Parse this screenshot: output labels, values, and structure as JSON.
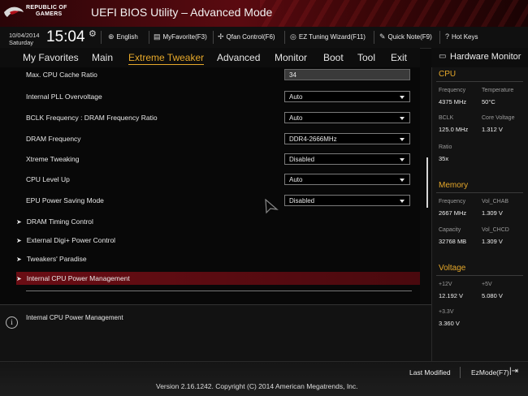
{
  "header": {
    "brand_line1": "REPUBLIC OF",
    "brand_line2": "GAMERS",
    "title": "UEFI BIOS Utility – Advanced Mode"
  },
  "infobar": {
    "date": "10/04/2014",
    "day": "Saturday",
    "time": "15:04",
    "items": [
      {
        "label": "English",
        "icon": "globe-icon"
      },
      {
        "label": "MyFavorite(F3)",
        "icon": "favorite-icon"
      },
      {
        "label": "Qfan Control(F6)",
        "icon": "fan-icon"
      },
      {
        "label": "EZ Tuning Wizard(F11)",
        "icon": "wizard-icon"
      },
      {
        "label": "Quick Note(F9)",
        "icon": "note-icon"
      },
      {
        "label": "Hot Keys",
        "icon": "hotkeys-icon"
      }
    ]
  },
  "nav": {
    "tabs": [
      "My Favorites",
      "Main",
      "Extreme Tweaker",
      "Advanced",
      "Monitor",
      "Boot",
      "Tool",
      "Exit"
    ],
    "active": "Extreme Tweaker"
  },
  "settings": [
    {
      "label": "Max. CPU Cache Ratio",
      "value": "34",
      "type": "text"
    },
    {
      "label": "Internal PLL Overvoltage",
      "value": "Auto",
      "type": "dropdown"
    },
    {
      "label": "BCLK Frequency : DRAM Frequency Ratio",
      "value": "Auto",
      "type": "dropdown"
    },
    {
      "label": "DRAM Frequency",
      "value": "DDR4-2666MHz",
      "type": "dropdown"
    },
    {
      "label": "Xtreme Tweaking",
      "value": "Disabled",
      "type": "dropdown"
    },
    {
      "label": "CPU Level Up",
      "value": "Auto",
      "type": "dropdown"
    },
    {
      "label": "EPU Power Saving Mode",
      "value": "Disabled",
      "type": "dropdown"
    }
  ],
  "submenus": [
    "DRAM Timing Control",
    "External Digi+ Power Control",
    "Tweakers' Paradise",
    "Internal CPU Power Management"
  ],
  "selected_submenu": "Internal CPU Power Management",
  "help_text": "Internal CPU Power Management",
  "hardware_monitor": {
    "title": "Hardware Monitor",
    "cpu": {
      "heading": "CPU",
      "frequency_label": "Frequency",
      "frequency": "4375 MHz",
      "temperature_label": "Temperature",
      "temperature": "50°C",
      "bclk_label": "BCLK",
      "bclk": "125.0 MHz",
      "core_voltage_label": "Core Voltage",
      "core_voltage": "1.312 V",
      "ratio_label": "Ratio",
      "ratio": "35x"
    },
    "memory": {
      "heading": "Memory",
      "frequency_label": "Frequency",
      "frequency": "2667 MHz",
      "vol_chab_label": "Vol_CHAB",
      "vol_chab": "1.309 V",
      "capacity_label": "Capacity",
      "capacity": "32768 MB",
      "vol_chcd_label": "Vol_CHCD",
      "vol_chcd": "1.309 V"
    },
    "voltage": {
      "heading": "Voltage",
      "v12_label": "+12V",
      "v12": "12.192 V",
      "v5_label": "+5V",
      "v5": "5.080 V",
      "v33_label": "+3.3V",
      "v33": "3.360 V"
    }
  },
  "footer": {
    "last_modified": "Last Modified",
    "ezmode": "EzMode(F7)",
    "version": "Version 2.16.1242. Copyright (C) 2014 American Megatrends, Inc."
  },
  "colors": {
    "accent": "#e6a82a",
    "selection": "#6a0d14",
    "header_red": "#5a0a10"
  }
}
